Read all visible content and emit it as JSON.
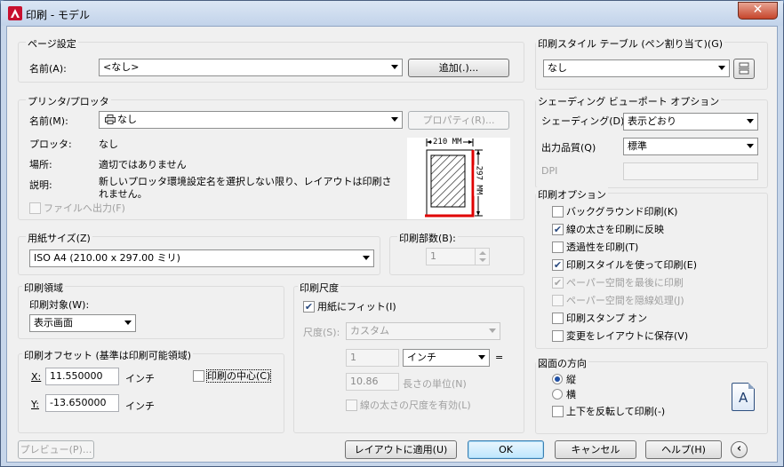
{
  "window": {
    "title": "印刷 - モデル",
    "close": "✕"
  },
  "page_setup": {
    "title": "ページ設定",
    "name_label": "名前(A):",
    "name_value": "<なし>",
    "add_button": "追加(.)..."
  },
  "printer": {
    "title": "プリンタ/プロッタ",
    "name_label": "名前(M):",
    "name_value": "なし",
    "properties_button": "プロパティ(R)...",
    "plotter_label": "プロッタ:",
    "plotter_value": "なし",
    "location_label": "場所:",
    "location_value": "適切ではありません",
    "description_label": "説明:",
    "description_value": "新しいプロッタ環境設定名を選択しない限り、レイアウトは印刷されません。",
    "print_to_file": "ファイルへ出力(F)",
    "preview_width": "210 MM",
    "preview_height": "297 MM"
  },
  "paper_size": {
    "title": "用紙サイズ(Z)",
    "value": "ISO A4 (210.00 x 297.00 ミリ)"
  },
  "copies": {
    "title": "印刷部数(B):",
    "value": "1"
  },
  "plot_area": {
    "title": "印刷領域",
    "what_label": "印刷対象(W):",
    "what_value": "表示画面"
  },
  "plot_offset": {
    "title": "印刷オフセット (基準は印刷可能領域)",
    "x_label": "X:",
    "x_value": "11.550000",
    "x_unit": "インチ",
    "y_label": "Y:",
    "y_value": "-13.650000",
    "y_unit": "インチ",
    "center_plot": "印刷の中心(C)"
  },
  "plot_scale": {
    "title": "印刷尺度",
    "fit_paper": "用紙にフィット(I)",
    "scale_label": "尺度(S):",
    "scale_value": "カスタム",
    "value1": "1",
    "unit": "インチ",
    "equals": "=",
    "value2": "10.86",
    "length_unit": "長さの単位(N)",
    "scale_lineweights": "線の太さの尺度を有効(L)"
  },
  "style_table": {
    "title": "印刷スタイル テーブル (ペン割り当て)(G)",
    "value": "なし"
  },
  "shaded": {
    "title": "シェーディング ビューポート オプション",
    "shade_label": "シェーディング(D)",
    "shade_value": "表示どおり",
    "quality_label": "出力品質(Q)",
    "quality_value": "標準",
    "dpi_label": "DPI"
  },
  "options": {
    "title": "印刷オプション",
    "items": [
      {
        "label": "バックグラウンド印刷(K)",
        "checked": false,
        "disabled": false
      },
      {
        "label": "線の太さを印刷に反映",
        "checked": true,
        "disabled": false
      },
      {
        "label": "透過性を印刷(T)",
        "checked": false,
        "disabled": false
      },
      {
        "label": "印刷スタイルを使って印刷(E)",
        "checked": true,
        "disabled": false
      },
      {
        "label": "ペーパー空間を最後に印刷",
        "checked": true,
        "disabled": true
      },
      {
        "label": "ペーパー空間を隠線処理(J)",
        "checked": false,
        "disabled": true
      },
      {
        "label": "印刷スタンプ オン",
        "checked": false,
        "disabled": false
      },
      {
        "label": "変更をレイアウトに保存(V)",
        "checked": false,
        "disabled": false
      }
    ]
  },
  "orientation": {
    "title": "図面の方向",
    "portrait": "縦",
    "landscape": "横",
    "upside_down": "上下を反転して印刷(-)",
    "icon_letter": "A"
  },
  "buttons": {
    "preview": "プレビュー(P)...",
    "apply": "レイアウトに適用(U)",
    "ok": "OK",
    "cancel": "キャンセル",
    "help": "ヘルプ(H)",
    "more": "‹"
  }
}
